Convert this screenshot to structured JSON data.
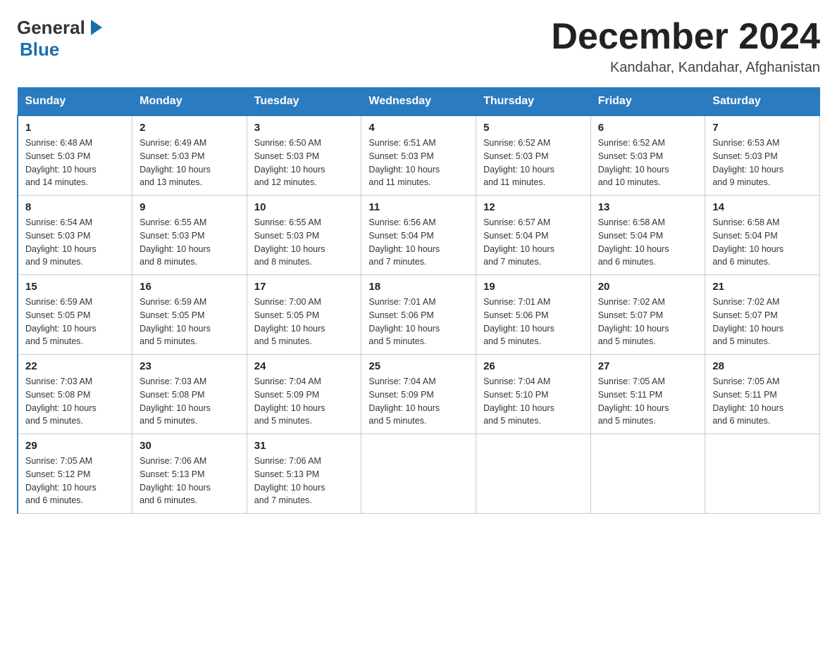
{
  "header": {
    "logo": {
      "general": "General",
      "blue": "Blue",
      "arrow": "▶"
    },
    "title": "December 2024",
    "location": "Kandahar, Kandahar, Afghanistan"
  },
  "calendar": {
    "days_of_week": [
      "Sunday",
      "Monday",
      "Tuesday",
      "Wednesday",
      "Thursday",
      "Friday",
      "Saturday"
    ],
    "weeks": [
      [
        {
          "day": "1",
          "sunrise": "6:48 AM",
          "sunset": "5:03 PM",
          "daylight": "10 hours and 14 minutes."
        },
        {
          "day": "2",
          "sunrise": "6:49 AM",
          "sunset": "5:03 PM",
          "daylight": "10 hours and 13 minutes."
        },
        {
          "day": "3",
          "sunrise": "6:50 AM",
          "sunset": "5:03 PM",
          "daylight": "10 hours and 12 minutes."
        },
        {
          "day": "4",
          "sunrise": "6:51 AM",
          "sunset": "5:03 PM",
          "daylight": "10 hours and 11 minutes."
        },
        {
          "day": "5",
          "sunrise": "6:52 AM",
          "sunset": "5:03 PM",
          "daylight": "10 hours and 11 minutes."
        },
        {
          "day": "6",
          "sunrise": "6:52 AM",
          "sunset": "5:03 PM",
          "daylight": "10 hours and 10 minutes."
        },
        {
          "day": "7",
          "sunrise": "6:53 AM",
          "sunset": "5:03 PM",
          "daylight": "10 hours and 9 minutes."
        }
      ],
      [
        {
          "day": "8",
          "sunrise": "6:54 AM",
          "sunset": "5:03 PM",
          "daylight": "10 hours and 9 minutes."
        },
        {
          "day": "9",
          "sunrise": "6:55 AM",
          "sunset": "5:03 PM",
          "daylight": "10 hours and 8 minutes."
        },
        {
          "day": "10",
          "sunrise": "6:55 AM",
          "sunset": "5:03 PM",
          "daylight": "10 hours and 8 minutes."
        },
        {
          "day": "11",
          "sunrise": "6:56 AM",
          "sunset": "5:04 PM",
          "daylight": "10 hours and 7 minutes."
        },
        {
          "day": "12",
          "sunrise": "6:57 AM",
          "sunset": "5:04 PM",
          "daylight": "10 hours and 7 minutes."
        },
        {
          "day": "13",
          "sunrise": "6:58 AM",
          "sunset": "5:04 PM",
          "daylight": "10 hours and 6 minutes."
        },
        {
          "day": "14",
          "sunrise": "6:58 AM",
          "sunset": "5:04 PM",
          "daylight": "10 hours and 6 minutes."
        }
      ],
      [
        {
          "day": "15",
          "sunrise": "6:59 AM",
          "sunset": "5:05 PM",
          "daylight": "10 hours and 5 minutes."
        },
        {
          "day": "16",
          "sunrise": "6:59 AM",
          "sunset": "5:05 PM",
          "daylight": "10 hours and 5 minutes."
        },
        {
          "day": "17",
          "sunrise": "7:00 AM",
          "sunset": "5:05 PM",
          "daylight": "10 hours and 5 minutes."
        },
        {
          "day": "18",
          "sunrise": "7:01 AM",
          "sunset": "5:06 PM",
          "daylight": "10 hours and 5 minutes."
        },
        {
          "day": "19",
          "sunrise": "7:01 AM",
          "sunset": "5:06 PM",
          "daylight": "10 hours and 5 minutes."
        },
        {
          "day": "20",
          "sunrise": "7:02 AM",
          "sunset": "5:07 PM",
          "daylight": "10 hours and 5 minutes."
        },
        {
          "day": "21",
          "sunrise": "7:02 AM",
          "sunset": "5:07 PM",
          "daylight": "10 hours and 5 minutes."
        }
      ],
      [
        {
          "day": "22",
          "sunrise": "7:03 AM",
          "sunset": "5:08 PM",
          "daylight": "10 hours and 5 minutes."
        },
        {
          "day": "23",
          "sunrise": "7:03 AM",
          "sunset": "5:08 PM",
          "daylight": "10 hours and 5 minutes."
        },
        {
          "day": "24",
          "sunrise": "7:04 AM",
          "sunset": "5:09 PM",
          "daylight": "10 hours and 5 minutes."
        },
        {
          "day": "25",
          "sunrise": "7:04 AM",
          "sunset": "5:09 PM",
          "daylight": "10 hours and 5 minutes."
        },
        {
          "day": "26",
          "sunrise": "7:04 AM",
          "sunset": "5:10 PM",
          "daylight": "10 hours and 5 minutes."
        },
        {
          "day": "27",
          "sunrise": "7:05 AM",
          "sunset": "5:11 PM",
          "daylight": "10 hours and 5 minutes."
        },
        {
          "day": "28",
          "sunrise": "7:05 AM",
          "sunset": "5:11 PM",
          "daylight": "10 hours and 6 minutes."
        }
      ],
      [
        {
          "day": "29",
          "sunrise": "7:05 AM",
          "sunset": "5:12 PM",
          "daylight": "10 hours and 6 minutes."
        },
        {
          "day": "30",
          "sunrise": "7:06 AM",
          "sunset": "5:13 PM",
          "daylight": "10 hours and 6 minutes."
        },
        {
          "day": "31",
          "sunrise": "7:06 AM",
          "sunset": "5:13 PM",
          "daylight": "10 hours and 7 minutes."
        },
        null,
        null,
        null,
        null
      ]
    ]
  }
}
